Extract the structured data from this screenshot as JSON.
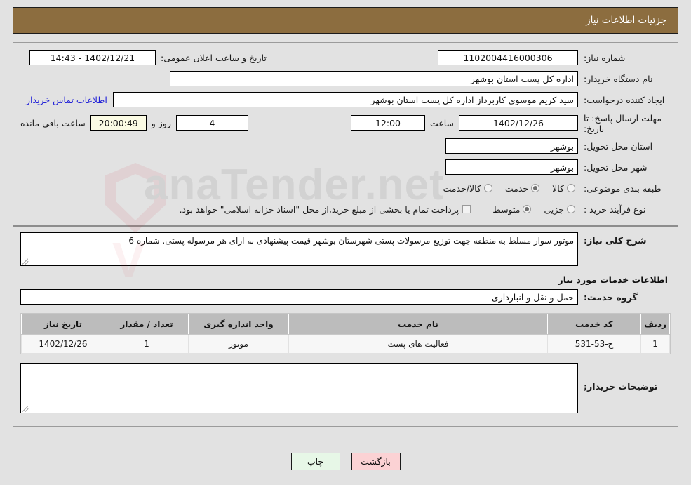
{
  "header": {
    "title": "جزئیات اطلاعات نیاز",
    "bar_color": "#8c6d3f"
  },
  "form": {
    "need_number_label": "شماره نیاز:",
    "need_number_value": "1102004416000306",
    "public_announce_label": "تاریخ و ساعت اعلان عمومی:",
    "public_announce_value": "1402/12/21 - 14:43",
    "buyer_org_label": "نام دستگاه خریدار:",
    "buyer_org_value": "اداره کل پست استان بوشهر",
    "requester_label": "ایجاد کننده درخواست:",
    "requester_value": "سید کریم موسوی کاربرداز اداره کل پست استان بوشهر",
    "contact_link": "اطلاعات تماس خریدار",
    "deadline_label": "مهلت ارسال پاسخ: تا تاریخ:",
    "deadline_date": "1402/12/26",
    "hour_label": "ساعت",
    "deadline_time": "12:00",
    "days_value": "4",
    "days_label": "روز و",
    "countdown_value": "20:00:49",
    "countdown_label": "ساعت باقي مانده",
    "province_label": "استان محل تحویل:",
    "province_value": "بوشهر",
    "city_label": "شهر محل تحویل:",
    "city_value": "بوشهر",
    "category_label": "طبقه بندی موضوعی:",
    "category_options": [
      {
        "label": "کالا",
        "selected": false
      },
      {
        "label": "خدمت",
        "selected": true
      },
      {
        "label": "کالا/خدمت",
        "selected": false
      }
    ],
    "process_label": "نوع فرآیند خرید :",
    "process_options": [
      {
        "label": "جزیی",
        "selected": false
      },
      {
        "label": "متوسط",
        "selected": true
      }
    ],
    "treasury_checkbox_label": "پرداخت تمام یا بخشی از مبلغ خرید،از محل \"اسناد خزانه اسلامی\" خواهد بود.",
    "treasury_checked": false
  },
  "description": {
    "label": "شرح کلی نیاز:",
    "value": "موتور سوار مسلط به منطقه جهت توزیع مرسولات پستی شهرستان بوشهر قیمت پیشنهادی به ازای هر مرسوله پستی. شماره 6"
  },
  "services": {
    "section_title": "اطلاعات خدمات مورد نیاز",
    "group_label": "گروه خدمت:",
    "group_value": "حمل و نقل و انبارداری",
    "columns": [
      "ردیف",
      "کد خدمت",
      "نام خدمت",
      "واحد اندازه گیری",
      "تعداد / مقدار",
      "تاریخ نیاز"
    ],
    "rows": [
      {
        "row": "1",
        "code": "ح-53-531",
        "name": "فعالیت های پست",
        "unit": "موتور",
        "qty": "1",
        "date": "1402/12/26"
      }
    ]
  },
  "buyer_notes": {
    "label": "توضیحات خریدار;",
    "value": ""
  },
  "footer": {
    "print_label": "چاپ",
    "back_label": "بازگشت"
  },
  "watermark": {
    "text": "anaTender.net"
  }
}
